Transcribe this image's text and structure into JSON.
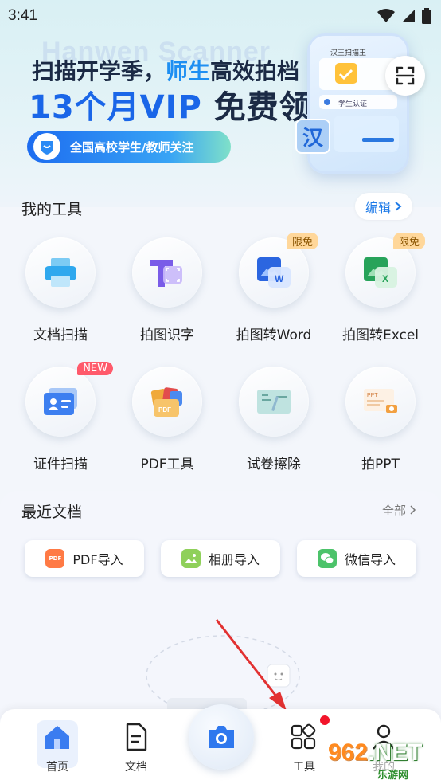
{
  "status_bar": {
    "time": "3:41"
  },
  "banner": {
    "watermark": "Hanwen Scanner",
    "line1_a": "扫描开学季，",
    "line1_b": "师生",
    "line1_c": "高效拍档",
    "line2_a": "13个月VIP",
    "line2_b": " 免费领",
    "pill_text": "全国高校学生/教师关注",
    "phone_title": "汉王扫描王",
    "phone_field": "学生认证",
    "phone_char": "汉"
  },
  "my_tools": {
    "title": "我的工具",
    "edit_label": "编辑",
    "items": [
      {
        "label": "文档扫描",
        "icon": "printer-icon",
        "tag": ""
      },
      {
        "label": "拍图识字",
        "icon": "text-recognition-icon",
        "tag": ""
      },
      {
        "label": "拍图转Word",
        "icon": "word-icon",
        "tag": "限免"
      },
      {
        "label": "拍图转Excel",
        "icon": "excel-icon",
        "tag": "限免"
      },
      {
        "label": "证件扫描",
        "icon": "id-card-icon",
        "tag": "NEW"
      },
      {
        "label": "PDF工具",
        "icon": "pdf-tools-icon",
        "tag": ""
      },
      {
        "label": "试卷擦除",
        "icon": "paper-erase-icon",
        "tag": ""
      },
      {
        "label": "拍PPT",
        "icon": "ppt-icon",
        "tag": ""
      }
    ]
  },
  "recent_docs": {
    "title": "最近文档",
    "all_label": "全部",
    "imports": [
      {
        "label": "PDF导入",
        "icon": "pdf-import-icon",
        "color": "#ff7a45"
      },
      {
        "label": "相册导入",
        "icon": "album-import-icon",
        "color": "#8fd05a"
      },
      {
        "label": "微信导入",
        "icon": "wechat-import-icon",
        "color": "#4cc36a"
      }
    ]
  },
  "bottom_nav": {
    "home": "首页",
    "docs": "文档",
    "tools": "工具",
    "profile": "我的"
  },
  "watermark": {
    "num": "962",
    "dot_net": ".NET",
    "sub": "乐游网"
  },
  "colors": {
    "accent": "#1f7be8",
    "red_dot": "#f2142a",
    "tag_free": "#ffd79a",
    "tag_new": "#ff5a6b"
  }
}
